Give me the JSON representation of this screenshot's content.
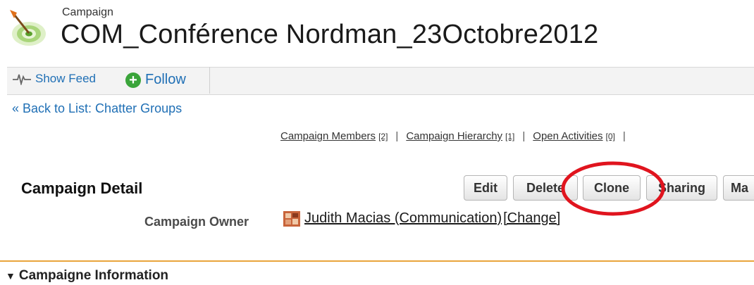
{
  "header": {
    "object_type": "Campaign",
    "title": "COM_Conférence Nordman_23Octobre2012",
    "icon": "target-icon"
  },
  "feed_bar": {
    "show_feed": "Show Feed",
    "follow": "Follow"
  },
  "back_link": "« Back to List: Chatter Groups",
  "related_links": [
    {
      "label": "Campaign Members",
      "count": "[2]"
    },
    {
      "label": "Campaign Hierarchy",
      "count": "[1]"
    },
    {
      "label": "Open Activities",
      "count": "[0]"
    }
  ],
  "detail": {
    "title": "Campaign Detail",
    "buttons": {
      "edit": "Edit",
      "delete": "Delete",
      "clone": "Clone",
      "sharing": "Sharing",
      "more": "Ma"
    },
    "owner_label": "Campaign Owner",
    "owner_name": "Judith Macias (Communication)",
    "owner_change": "[Change]"
  },
  "section": {
    "title": "Campaigne Information",
    "expanded_glyph": "▼"
  },
  "colors": {
    "link": "#1f6fb5",
    "section_rule": "#e9a53c",
    "highlight": "#e0141e",
    "follow_icon": "#3aa43a"
  }
}
